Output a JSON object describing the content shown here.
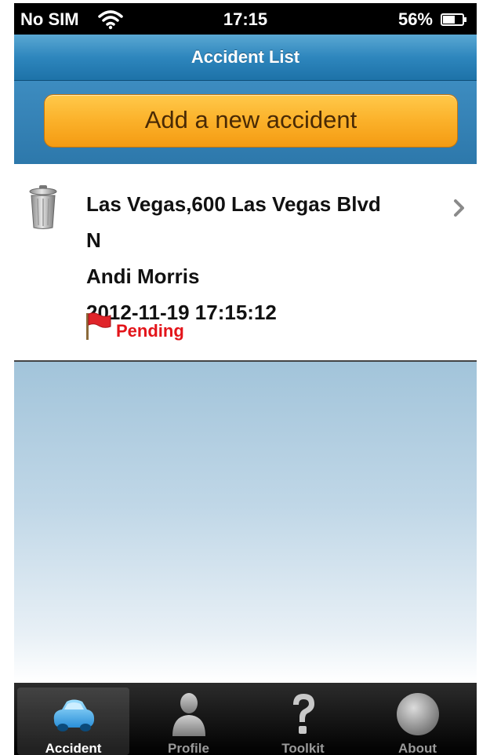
{
  "status_bar": {
    "carrier": "No SIM",
    "time": "17:15",
    "battery": "56%"
  },
  "nav": {
    "title": "Accident List"
  },
  "add_button": {
    "label": "Add a new accident"
  },
  "accidents": [
    {
      "address_line1": "Las Vegas,600 Las Vegas Blvd",
      "address_line2": "N",
      "name": "Andi Morris",
      "datetime": "2012-11-19 17:15:12",
      "status": "Pending"
    }
  ],
  "tabs": [
    {
      "label": "Accident",
      "icon": "car-icon",
      "selected": true
    },
    {
      "label": "Profile",
      "icon": "person-icon",
      "selected": false
    },
    {
      "label": "Toolkit",
      "icon": "question-icon",
      "selected": false
    },
    {
      "label": "About",
      "icon": "circle-icon",
      "selected": false
    }
  ],
  "colors": {
    "accent_blue": "#2e86bd",
    "button_orange": "#fbb12a",
    "status_red": "#e3141a"
  }
}
